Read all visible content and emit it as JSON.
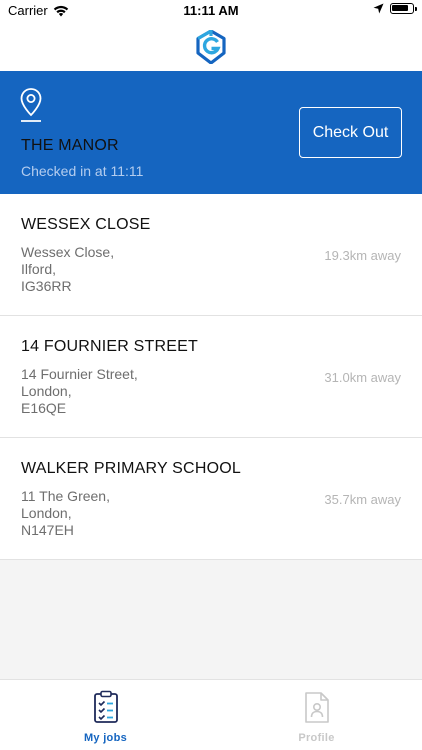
{
  "status_bar": {
    "carrier": "Carrier",
    "time": "11:11 AM"
  },
  "nav": {
    "logo_icon": "brand-logo-icon"
  },
  "active_job": {
    "title": "THE MANOR",
    "checked_in": "Checked in at 11:11",
    "checkout_label": "Check Out",
    "icon": "location-pin-icon"
  },
  "jobs": [
    {
      "title": "WESSEX CLOSE",
      "address": [
        "Wessex Close,",
        "Ilford,",
        "IG36RR"
      ],
      "distance": "19.3km away"
    },
    {
      "title": "14 FOURNIER STREET",
      "address": [
        "14 Fournier Street,",
        "London,",
        "E16QE"
      ],
      "distance": "31.0km away"
    },
    {
      "title": "WALKER PRIMARY SCHOOL",
      "address": [
        "11 The Green,",
        "London,",
        "N147EH"
      ],
      "distance": "35.7km away"
    }
  ],
  "tabs": [
    {
      "label": "My jobs",
      "icon": "clipboard-checklist-icon",
      "active": true
    },
    {
      "label": "Profile",
      "icon": "profile-document-icon",
      "active": false
    }
  ],
  "colors": {
    "primary": "#1565c0",
    "background": "#f4f4f4",
    "inactive": "#c8c8c8"
  }
}
